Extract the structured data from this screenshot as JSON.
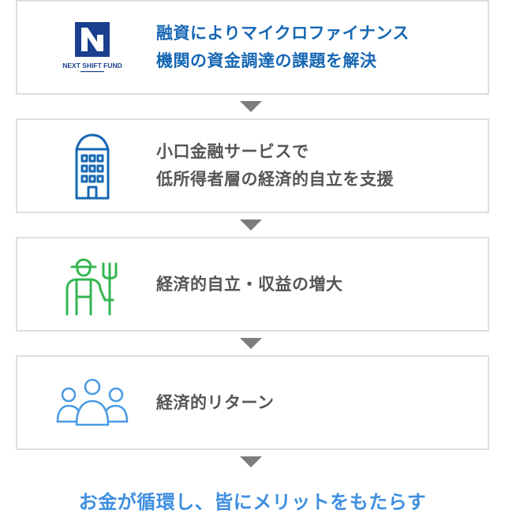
{
  "steps": [
    {
      "lines": [
        "融資によりマイクロファイナンス",
        "機関の資金調達の課題を解決"
      ],
      "icon": "next-shift-fund-logo",
      "logo_text": "NEXT SHIFT FUND",
      "text_color": "#1667b3"
    },
    {
      "lines": [
        "小口金融サービスで",
        "低所得者層の経済的自立を支援"
      ],
      "icon": "building-icon",
      "icon_color": "#1667b3",
      "text_color": "#555555"
    },
    {
      "lines": [
        "経済的自立・収益の増大"
      ],
      "icon": "farmer-pitchfork-icon",
      "icon_color": "#35b551",
      "text_color": "#555555"
    },
    {
      "lines": [
        "経済的リターン"
      ],
      "icon": "people-group-icon",
      "icon_color": "#4a9be4",
      "text_color": "#555555"
    }
  ],
  "footer": {
    "text": "お金が循環し、皆にメリットをもたらす",
    "color": "#3f8fe0"
  },
  "colors": {
    "border": "#dedede",
    "arrow": "#7d7d7d"
  }
}
